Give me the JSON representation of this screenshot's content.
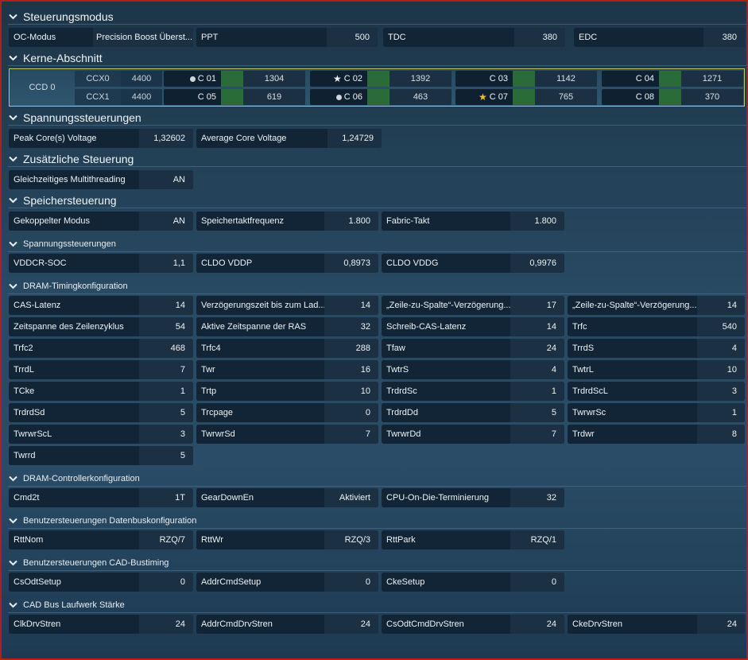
{
  "sections": {
    "steuerungsmodus": "Steuerungsmodus",
    "kerne": "Kerne-Abschnitt",
    "spannung": "Spannungssteuerungen",
    "zusatz": "Zusätzliche Steuerung",
    "speicher": "Speichersteuerung",
    "spannung2": "Spannungssteuerungen",
    "dram_timing": "DRAM-Timingkonfiguration",
    "dram_ctrl": "DRAM-Controllerkonfiguration",
    "datenbus": "Benutzersteuerungen Datenbuskonfiguration",
    "cad_bustiming": "Benutzersteuerungen CAD-Bustiming",
    "cad_staerke": "CAD Bus Laufwerk Stärke"
  },
  "modus": {
    "oc_label": "OC-Modus",
    "oc_value": "Precision Boost Überst...",
    "ppt_label": "PPT",
    "ppt_value": "500",
    "tdc_label": "TDC",
    "tdc_value": "380",
    "edc_label": "EDC",
    "edc_value": "380"
  },
  "kerne": {
    "ccd": "CCD 0",
    "ccx": [
      {
        "name": "CCX0",
        "value": "4400"
      },
      {
        "name": "CCX1",
        "value": "4400"
      }
    ],
    "cores": [
      {
        "name": "C 01",
        "value": "1304",
        "marker": "dot"
      },
      {
        "name": "C 02",
        "value": "1392",
        "marker": "star-white"
      },
      {
        "name": "C 03",
        "value": "1142",
        "marker": ""
      },
      {
        "name": "C 04",
        "value": "1271",
        "marker": ""
      },
      {
        "name": "C 05",
        "value": "619",
        "marker": ""
      },
      {
        "name": "C 06",
        "value": "463",
        "marker": "dot"
      },
      {
        "name": "C 07",
        "value": "765",
        "marker": "star-gold"
      },
      {
        "name": "C 08",
        "value": "370",
        "marker": ""
      }
    ]
  },
  "spannung": {
    "peak_label": "Peak Core(s) Voltage",
    "peak_value": "1,32602",
    "avg_label": "Average Core Voltage",
    "avg_value": "1,24729"
  },
  "zusatz": {
    "smt_label": "Gleichzeitiges Multithreading",
    "smt_value": "AN"
  },
  "speicher": {
    "gek_label": "Gekoppelter Modus",
    "gek_value": "AN",
    "takt_label": "Speichertaktfrequenz",
    "takt_value": "1.800",
    "fabric_label": "Fabric-Takt",
    "fabric_value": "1.800"
  },
  "spannung2": {
    "vddcr_label": "VDDCR-SOC",
    "vddcr_value": "1,1",
    "vddp_label": "CLDO VDDP",
    "vddp_value": "0,8973",
    "vddg_label": "CLDO VDDG",
    "vddg_value": "0,9976"
  },
  "timing": [
    {
      "label": "CAS-Latenz",
      "value": "14"
    },
    {
      "label": "Verzögerungszeit bis zum Lad...",
      "value": "14"
    },
    {
      "label": "„Zeile-zu-Spalte“-Verzögerung...",
      "value": "17"
    },
    {
      "label": "„Zeile-zu-Spalte“-Verzögerung...",
      "value": "14"
    },
    {
      "label": "Zeitspanne des Zeilenzyklus",
      "value": "54"
    },
    {
      "label": "Aktive Zeitspanne der RAS",
      "value": "32"
    },
    {
      "label": "Schreib-CAS-Latenz",
      "value": "14"
    },
    {
      "label": "Trfc",
      "value": "540"
    },
    {
      "label": "Trfc2",
      "value": "468"
    },
    {
      "label": "Trfc4",
      "value": "288"
    },
    {
      "label": "Tfaw",
      "value": "24"
    },
    {
      "label": "TrrdS",
      "value": "4"
    },
    {
      "label": "TrrdL",
      "value": "7"
    },
    {
      "label": "Twr",
      "value": "16"
    },
    {
      "label": "TwtrS",
      "value": "4"
    },
    {
      "label": "TwtrL",
      "value": "10"
    },
    {
      "label": "TCke",
      "value": "1"
    },
    {
      "label": "Trtp",
      "value": "10"
    },
    {
      "label": "TrdrdSc",
      "value": "1"
    },
    {
      "label": "TrdrdScL",
      "value": "3"
    },
    {
      "label": "TrdrdSd",
      "value": "5"
    },
    {
      "label": "Trcpage",
      "value": "0"
    },
    {
      "label": "TrdrdDd",
      "value": "5"
    },
    {
      "label": "TwrwrSc",
      "value": "1"
    },
    {
      "label": "TwrwrScL",
      "value": "3"
    },
    {
      "label": "TwrwrSd",
      "value": "7"
    },
    {
      "label": "TwrwrDd",
      "value": "7"
    },
    {
      "label": "Trdwr",
      "value": "8"
    },
    {
      "label": "Twrrd",
      "value": "5"
    }
  ],
  "dram_ctrl": [
    {
      "label": "Cmd2t",
      "value": "1T"
    },
    {
      "label": "GearDownEn",
      "value": "Aktiviert"
    },
    {
      "label": "CPU-On-Die-Terminierung",
      "value": "32"
    }
  ],
  "datenbus": [
    {
      "label": "RttNom",
      "value": "RZQ/7"
    },
    {
      "label": "RttWr",
      "value": "RZQ/3"
    },
    {
      "label": "RttPark",
      "value": "RZQ/1"
    }
  ],
  "cad_bustiming": [
    {
      "label": "CsOdtSetup",
      "value": "0"
    },
    {
      "label": "AddrCmdSetup",
      "value": "0"
    },
    {
      "label": "CkeSetup",
      "value": "0"
    }
  ],
  "cad_staerke": [
    {
      "label": "ClkDrvStren",
      "value": "24"
    },
    {
      "label": "AddrCmdDrvStren",
      "value": "24"
    },
    {
      "label": "CsOdtCmdDrvStren",
      "value": "24"
    },
    {
      "label": "CkeDrvStren",
      "value": "24"
    }
  ]
}
